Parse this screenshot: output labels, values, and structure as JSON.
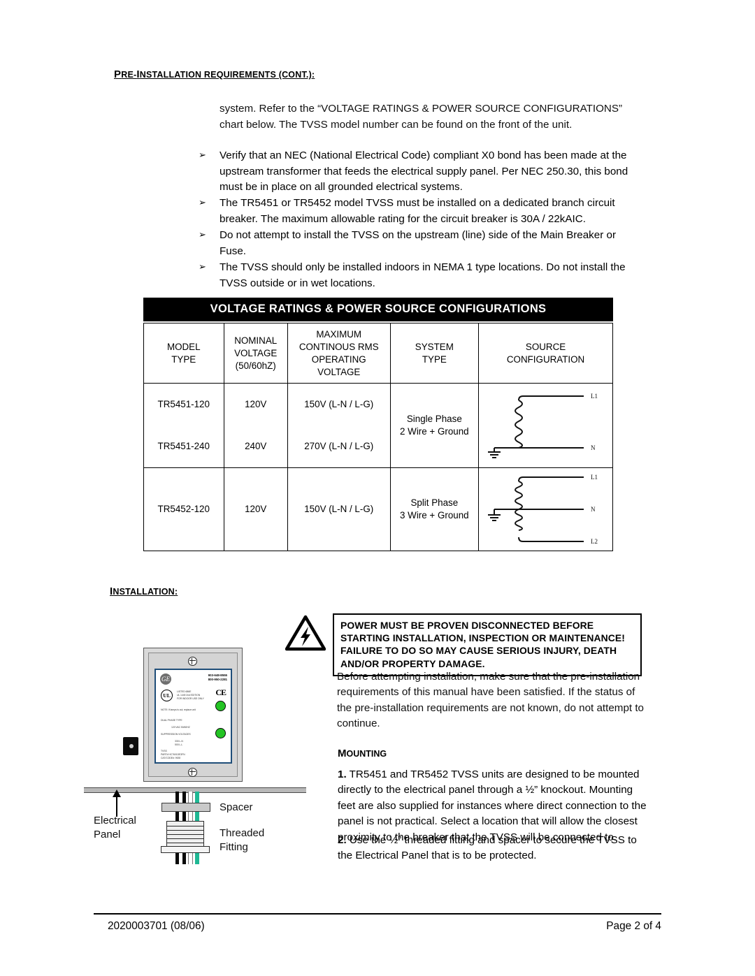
{
  "headings": {
    "pre_install": {
      "first": "P",
      "rest_caps": "RE-I",
      "word1": "NSTALLATION REQUIREMENTS (CONT.):"
    },
    "pre_install_full": "PRE-INSTALLATION REQUIREMENTS (CONT.):",
    "installation": "INSTALLATION:",
    "mounting": "MOUNTING"
  },
  "intro_paragraph": "system.   Refer to the “VOLTAGE RATINGS & POWER SOURCE CONFIGURATIONS” chart below.  The TVSS model number can be found on the front of the unit.",
  "bullets": [
    {
      "marker": "➢",
      "text": "Verify that an NEC (National Electrical Code) compliant X0 bond has been made at the upstream transformer that feeds the electrical supply panel.  Per NEC 250.30, this bond must be in place on all grounded electrical systems."
    },
    {
      "marker": "➢",
      "text": "The TR5451 or TR5452 model TVSS must be installed on a dedicated branch circuit breaker.  The maximum allowable rating for the circuit breaker is 30A / 22kAIC."
    },
    {
      "marker": "➢",
      "text": "Do not attempt to install the TVSS on the upstream (line) side of the Main Breaker or Fuse."
    },
    {
      "marker": "➢",
      "text": "The TVSS should only be installed indoors in NEMA 1 type locations.  Do not install the TVSS outside or in wet locations."
    }
  ],
  "table": {
    "title": "VOLTAGE RATINGS & POWER SOURCE CONFIGURATIONS",
    "headers": [
      "MODEL\nTYPE",
      "NOMINAL\nVOLTAGE\n(50/60hZ)",
      "MAXIMUM\nCONTINOUS RMS\nOPERATING\nVOLTAGE",
      "SYSTEM\nTYPE",
      "SOURCE\nCONFIGURATION"
    ],
    "header_lines": {
      "model": [
        "MODEL",
        "TYPE"
      ],
      "nominal": [
        "NOMINAL",
        "VOLTAGE",
        "(50/60hZ)"
      ],
      "maximum": [
        "MAXIMUM",
        "CONTINOUS RMS",
        "OPERATING",
        "VOLTAGE"
      ],
      "system": [
        "SYSTEM",
        "TYPE"
      ],
      "source": [
        "SOURCE",
        "CONFIGURATION"
      ]
    },
    "groups": [
      {
        "system_type_lines": [
          "Single Phase",
          "2 Wire + Ground"
        ],
        "diagram": "single-phase-diagram",
        "diagram_labels": [
          "L1",
          "N"
        ],
        "rows": [
          {
            "model": "TR5451-120",
            "nominal": "120V",
            "maximum": "150V  (L-N / L-G)"
          },
          {
            "model": "TR5451-240",
            "nominal": "240V",
            "maximum": "270V  (L-N / L-G)"
          }
        ]
      },
      {
        "system_type_lines": [
          "Split Phase",
          "3 Wire + Ground"
        ],
        "diagram": "split-phase-diagram",
        "diagram_labels": [
          "L1",
          "N",
          "L2"
        ],
        "rows": [
          {
            "model": "TR5452-120",
            "nominal": "120V",
            "maximum": "150V  (L-N / L-G)"
          }
        ]
      }
    ]
  },
  "warning": {
    "icon": "electric-shock-hazard-icon",
    "lines": [
      "POWER MUST BE PROVEN DISCONNECTED BEFORE",
      "STARTING INSTALLATION, INSPECTION OR MAINTENANCE!",
      "FAILURE TO DO SO MAY CAUSE SERIOUS INJURY, DEATH",
      "AND/OR PROPERTY DAMAGE."
    ]
  },
  "before_paragraph": "Before attempting installation, make sure that the pre-installation requirements of this manual have been satisfied.  If the status of the pre-installation requirements are not known, do not attempt to continue.",
  "steps": [
    {
      "number": "1.",
      "text": "TR5451 and TR5452 TVSS units are designed to be mounted directly to the electrical panel through a ½” knockout.  Mounting feet are also supplied for instances where direct connection to the panel is not practical.  Select a location that will allow the closest proximity to the breaker that the TVSS will be connected to."
    },
    {
      "number": "2.",
      "text": "Use the ½” threaded fitting and spacer to secure the TVSS to the Electrical Panel that is to be protected."
    }
  ],
  "illustration": {
    "device_label": {
      "brand": "GE",
      "phone_1": "903-648-8555",
      "phone_2": "800-950-2281",
      "ce_mark": "CE",
      "ul_mark": "UL",
      "micro_lines": [
        "LISTED 686E",
        "UL 1449 2nd EDITION",
        "FOR INDOOR USE ONLY",
        "NOTE: If lamps is out, replace unit",
        "DUAL PHASE TYPE",
        "120 VAC 50/60HZ",
        "SUPPRESSION VOLTAGES",
        "330 L-N",
        "500 L-L",
        "TVSS",
        "PART# HC7601DE3FN",
        "CAT/CODE#:   9928"
      ]
    },
    "callouts": {
      "electrical_panel": [
        "Electrical",
        "Panel"
      ],
      "spacer": "Spacer",
      "threaded_fitting": [
        "Threaded",
        "Fitting"
      ]
    },
    "wire_colors": {
      "line": "#0a0a0a",
      "neutral": "#ffffff",
      "ground": "#1fb894"
    }
  },
  "footer": {
    "document_number": "2020003701   (08/06)",
    "page_label": "Page 2 of 4"
  },
  "colors": {
    "title_bar_bg": "#000000",
    "title_bar_text": "#ffffff",
    "label_border": "#1f4e79",
    "led_green": "#24c424"
  }
}
